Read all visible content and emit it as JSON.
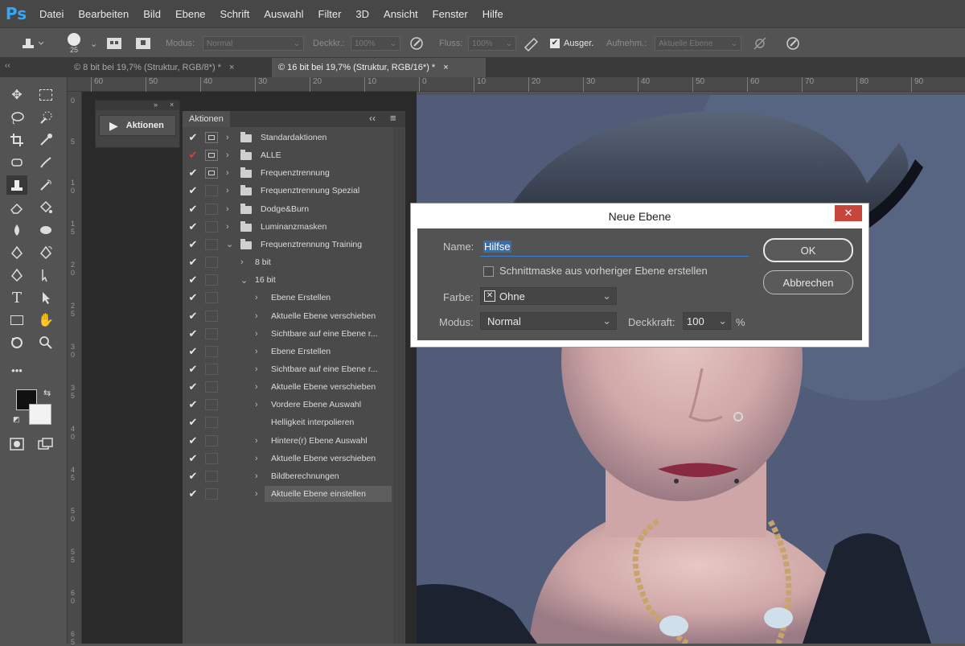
{
  "app": {
    "logo": "Ps"
  },
  "menu": [
    "Datei",
    "Bearbeiten",
    "Bild",
    "Ebene",
    "Schrift",
    "Auswahl",
    "Filter",
    "3D",
    "Ansicht",
    "Fenster",
    "Hilfe"
  ],
  "options": {
    "brush_size": "25",
    "modus_label": "Modus:",
    "modus_value": "Normal",
    "deckkr_label": "Deckkr.:",
    "deckkr_value": "100%",
    "fluss_label": "Fluss:",
    "fluss_value": "100%",
    "ausger_label": "Ausger.",
    "aufnehm_label": "Aufnehm.:",
    "aufnehm_value": "Aktuelle Ebene"
  },
  "tabs": [
    {
      "label": "© 8 bit bei 19,7% (Struktur, RGB/8*) *",
      "close": "×"
    },
    {
      "label": "© 16 bit bei 19,7% (Struktur, RGB/16*) *",
      "close": "×"
    }
  ],
  "rulers": {
    "top": [
      "60",
      "50",
      "40",
      "30",
      "20",
      "10",
      "0",
      "10",
      "20",
      "30",
      "40",
      "50",
      "60",
      "70",
      "80",
      "90"
    ],
    "left": [
      "0",
      "5",
      "1 0",
      "1 5",
      "2 0",
      "2 5",
      "3 0",
      "3 5",
      "4 0",
      "4 5",
      "5 0",
      "5 5",
      "6 0",
      "6 5"
    ]
  },
  "small_panel": {
    "button": "Aktionen"
  },
  "actions": {
    "tab": "Aktionen",
    "rows": [
      {
        "label": "Standardaktionen",
        "check": "✔",
        "check_color": "#e6e6e6",
        "dialog": true,
        "type": "set"
      },
      {
        "label": "ALLE",
        "check": "✔",
        "check_color": "#d9403a",
        "dialog": true,
        "type": "set"
      },
      {
        "label": "Frequenztrennung",
        "check": "✔",
        "check_color": "#e6e6e6",
        "dialog": true,
        "type": "set"
      },
      {
        "label": "Frequenztrennung Spezial",
        "check": "✔",
        "check_color": "#e6e6e6",
        "dialog": false,
        "type": "set"
      },
      {
        "label": "Dodge&Burn",
        "check": "✔",
        "check_color": "#e6e6e6",
        "dialog": false,
        "type": "set"
      },
      {
        "label": "Luminanzmasken",
        "check": "✔",
        "check_color": "#e6e6e6",
        "dialog": false,
        "type": "set"
      },
      {
        "label": "Frequenztrennung Training",
        "check": "✔",
        "check_color": "#e6e6e6",
        "dialog": false,
        "type": "set-open"
      },
      {
        "label": "8 bit",
        "check": "✔",
        "check_color": "#e6e6e6",
        "dialog": false,
        "type": "action"
      },
      {
        "label": "16 bit",
        "check": "✔",
        "check_color": "#e6e6e6",
        "dialog": false,
        "type": "action-open"
      },
      {
        "label": "Ebene Erstellen",
        "check": "✔",
        "check_color": "#e6e6e6",
        "dialog": false,
        "type": "step"
      },
      {
        "label": "Aktuelle Ebene verschieben",
        "check": "✔",
        "check_color": "#e6e6e6",
        "dialog": false,
        "type": "step"
      },
      {
        "label": "Sichtbare auf eine Ebene r...",
        "check": "✔",
        "check_color": "#e6e6e6",
        "dialog": false,
        "type": "step"
      },
      {
        "label": "Ebene Erstellen",
        "check": "✔",
        "check_color": "#e6e6e6",
        "dialog": false,
        "type": "step"
      },
      {
        "label": "Sichtbare auf eine Ebene r...",
        "check": "✔",
        "check_color": "#e6e6e6",
        "dialog": false,
        "type": "step"
      },
      {
        "label": "Aktuelle Ebene verschieben",
        "check": "✔",
        "check_color": "#e6e6e6",
        "dialog": false,
        "type": "step"
      },
      {
        "label": "Vordere Ebene Auswahl",
        "check": "✔",
        "check_color": "#e6e6e6",
        "dialog": false,
        "type": "step"
      },
      {
        "label": "Helligkeit interpolieren",
        "check": "✔",
        "check_color": "#e6e6e6",
        "dialog": false,
        "type": "step-nochev"
      },
      {
        "label": "Hintere(r) Ebene Auswahl",
        "check": "✔",
        "check_color": "#e6e6e6",
        "dialog": false,
        "type": "step"
      },
      {
        "label": "Aktuelle Ebene verschieben",
        "check": "✔",
        "check_color": "#e6e6e6",
        "dialog": false,
        "type": "step"
      },
      {
        "label": "Bildberechnungen",
        "check": "✔",
        "check_color": "#e6e6e6",
        "dialog": false,
        "type": "step"
      },
      {
        "label": "Aktuelle Ebene einstellen",
        "check": "✔",
        "check_color": "#e6e6e6",
        "dialog": false,
        "type": "step-selected"
      }
    ]
  },
  "dialog": {
    "title": "Neue Ebene",
    "close": "✕",
    "name_label": "Name:",
    "name_value": "Hilfse",
    "clip_label": "Schnittmaske aus vorheriger Ebene erstellen",
    "farbe_label": "Farbe:",
    "farbe_value": "Ohne",
    "modus_label": "Modus:",
    "modus_value": "Normal",
    "deckkraft_label": "Deckkraft:",
    "deckkraft_value": "100",
    "percent": "%",
    "ok": "OK",
    "cancel": "Abbrechen"
  }
}
